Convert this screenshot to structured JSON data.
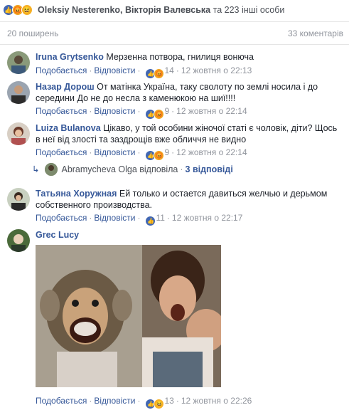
{
  "reactions": {
    "names": "Oleksiy Nesterenko, Вікторія Валевська",
    "others": "та 223 інші особи"
  },
  "counts": {
    "shares": "20 поширень",
    "comments": "33 коментарів"
  },
  "actions": {
    "like": "Подобається",
    "reply": "Відповісти"
  },
  "comments": [
    {
      "author": "Iruna Grytsenko",
      "text": "Мерзенна потвора, гнилиця вонюча",
      "reactions": "14",
      "time": "12 жовтня о 22:13"
    },
    {
      "author": "Назар Дорош",
      "text": "От матінка Україна, таку сволоту по землі носила і до середини До не до несла з каменюкою на шиї!!!!",
      "reactions": "9",
      "time": "12 жовтня о 22:14"
    },
    {
      "author": "Luiza Bulanova",
      "text": "Цікаво, у той особини жіночої статі є чоловік, діти? Щось в неї від злості та заздрощів вже обличчя не видно",
      "reactions": "9",
      "time": "12 жовтня о 22:14",
      "reply_author": "Abramycheva Olga відповіла",
      "reply_count": "3 відповіді"
    },
    {
      "author": "Татьяна Хоружная",
      "text": "Ей только и остается давиться желчью и дерьмом собственного производства.",
      "reactions": "11",
      "time": "12 жовтня о 22:17"
    },
    {
      "author": "Grec Lucy",
      "text": "",
      "reactions": "13",
      "time": "12 жовтня о 22:26"
    }
  ],
  "colors": {
    "link": "#365899",
    "muted": "#90949c",
    "like": "#4267b2"
  },
  "icons": [
    "like-icon",
    "angry-icon",
    "haha-icon",
    "reply-arrow-icon"
  ]
}
